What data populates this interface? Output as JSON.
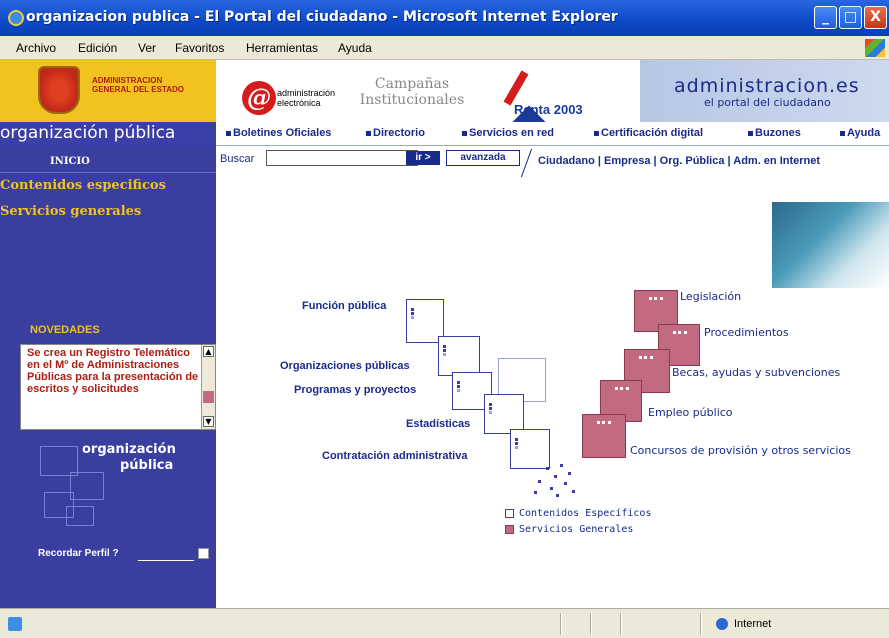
{
  "window": {
    "title": "organizacion publica - El Portal del ciudadano - Microsoft Internet Explorer",
    "controls": [
      "_",
      "□",
      "X"
    ]
  },
  "menubar": [
    "Archivo",
    "Edición",
    "Ver",
    "Favoritos",
    "Herramientas",
    "Ayuda"
  ],
  "header": {
    "gov_logo_text": "ADMINISTRACION GENERAL DEL ESTADO",
    "ae_line1": "administración",
    "ae_line2": "electrónica",
    "campanas_line1": "Campañas",
    "campanas_line2": "Institucionales",
    "renta": "Renta 2003",
    "portal_title": "administracion.es",
    "portal_subtitle": "el portal del ciudadano"
  },
  "nav": {
    "brand": "organización pública",
    "items": [
      "Boletines Oficiales",
      "Directorio",
      "Servicios en red",
      "Certificación digital",
      "Buzones",
      "Ayuda"
    ]
  },
  "search": {
    "label": "Buscar",
    "value": "",
    "go": "ir >",
    "advanced": "avanzada",
    "audience_links": "Ciudadano | Empresa | Org. Pública | Adm. en Internet"
  },
  "sidebar": {
    "inicio": "INICIO",
    "links": [
      "Contenidos especificos",
      "Servicios generales"
    ],
    "novedades": "NOVEDADES",
    "news_text": "Se crea un Registro Telemático en el Mº de Administraciones Públicas para la presentación de escritos y solicitudes",
    "org_line1": "organización",
    "org_line2": "pública",
    "recordar": "Recordar Perfil ?"
  },
  "content": {
    "especificos": [
      "Función pública",
      "Organizaciones públicas",
      "Programas y proyectos",
      "Estadísticas",
      "Contratación administrativa"
    ],
    "generales": [
      "Legislación",
      "Procedimientos",
      "Becas, ayudas y subvenciones",
      "Empleo público",
      "Concursos de provisión y otros servicios"
    ],
    "legend": [
      "Contenidos Específicos",
      "Servicios Generales"
    ]
  },
  "status": {
    "zone": "Internet"
  },
  "colors": {
    "titlebar": "#0b49c6",
    "sidebar": "#3a3e9e",
    "accent_yellow": "#f2c220",
    "servicios_pink": "#c26a80",
    "nav_text": "#1a2a8a"
  }
}
